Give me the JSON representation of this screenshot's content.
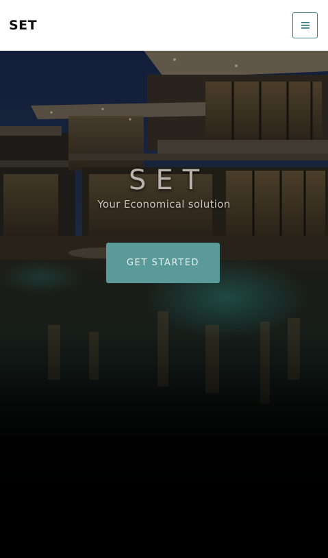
{
  "navbar": {
    "brand": "SET",
    "menu_icon": "hamburger-icon"
  },
  "hero": {
    "title": "SET",
    "subtitle": "Your Economical solution",
    "cta_label": "GET STARTED"
  },
  "colors": {
    "accent": "#5a9a98",
    "menu_border": "#3d7f84",
    "navbar_bg": "#ffffff",
    "hero_bg": "#000000"
  }
}
